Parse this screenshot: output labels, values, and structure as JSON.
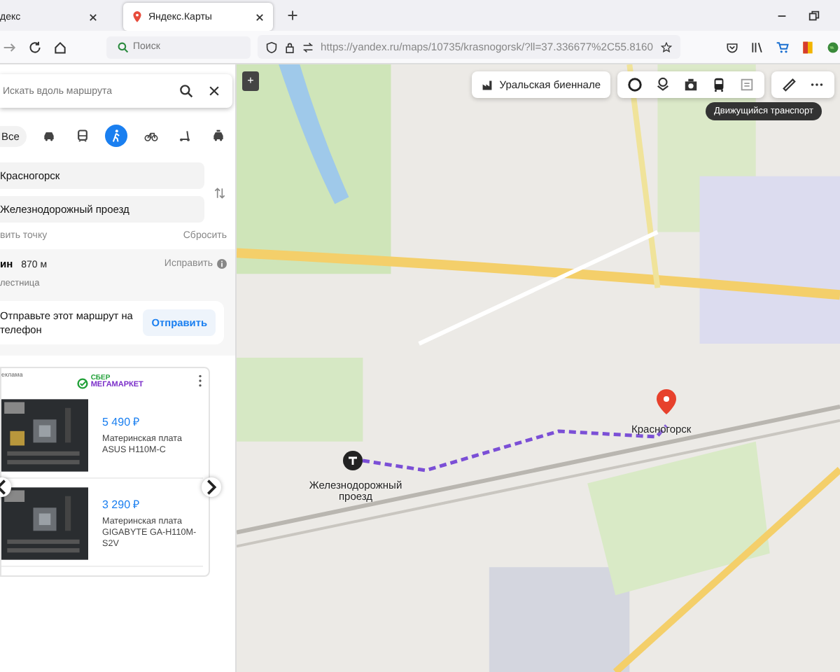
{
  "browser": {
    "tabs": [
      {
        "title": "декс",
        "selected": false
      },
      {
        "title": "Яндекс.Карты",
        "selected": true
      }
    ],
    "search_placeholder": "Поиск",
    "url": "https://yandex.ru/maps/10735/krasnogorsk/?ll=37.336677%2C55.8160"
  },
  "route_panel": {
    "search": {
      "placeholder": "Искать вдоль маршрута"
    },
    "modes": [
      {
        "kind": "all",
        "label": "Все",
        "selected": false
      },
      {
        "kind": "car",
        "selected": false
      },
      {
        "kind": "bus",
        "selected": false
      },
      {
        "kind": "walk",
        "selected": true
      },
      {
        "kind": "bike",
        "selected": false
      },
      {
        "kind": "scooter",
        "selected": false
      },
      {
        "kind": "taxi",
        "selected": false
      }
    ],
    "from": "Красногорск",
    "to": "Железнодорожный проезд",
    "add_point": "вить точку",
    "reset": "Сбросить",
    "summary": {
      "time": "ин",
      "distance": "870 м",
      "fix": "Исправить",
      "note": "лестница"
    },
    "send": {
      "text": "Отправьте этот маршрут на телефон",
      "button": "Отправить"
    },
    "ad": {
      "label": "еклама",
      "logo_top": "СБЕР",
      "logo_bottom": "МЕГАМАРКЕТ",
      "products": [
        {
          "price": "5 490 ₽",
          "name": "Материнская плата ASUS H110M-C"
        },
        {
          "price": "3 290 ₽",
          "name": "Материнская плата GIGABYTE GA-H110M-S2V"
        }
      ]
    }
  },
  "map": {
    "zoom_button": "+",
    "event": "Уральская биеннале",
    "tools": [
      {
        "kind": "ring"
      },
      {
        "kind": "layers"
      },
      {
        "kind": "camera"
      },
      {
        "kind": "bus"
      },
      {
        "kind": "panel"
      }
    ],
    "tooltip": "Движущийся транспорт",
    "start_label": "Железнодорожный проезд",
    "end_label": "Красногорск"
  }
}
